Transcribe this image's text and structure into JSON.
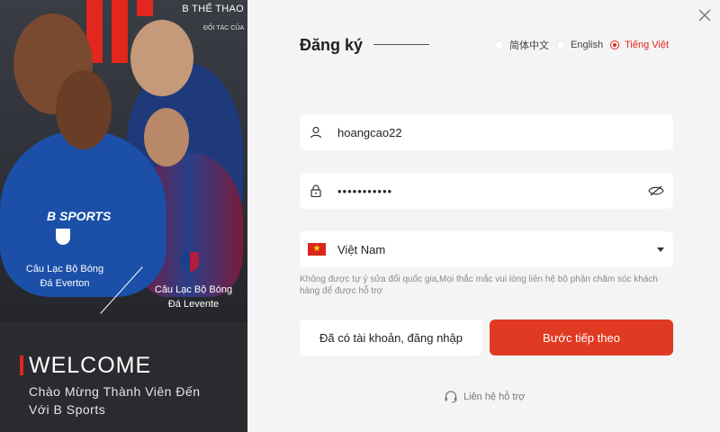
{
  "left": {
    "brand_title": "B THỂ THAO",
    "brand_sub": "ĐỐI TÁC CỦA",
    "club_everton": "Câu Lạc Bộ Bóng\nĐá Everton",
    "club_levante": "Câu Lạc Bộ Bóng\nĐá Levente",
    "jersey_text": "B SPORTS",
    "welcome_title": "WELCOME",
    "welcome_line1": "Chào Mừng Thành Viên Đến",
    "welcome_line2": "Với B  Sports"
  },
  "form": {
    "title": "Đăng ký",
    "languages": [
      {
        "label": "简体中文",
        "selected": false
      },
      {
        "label": "English",
        "selected": false
      },
      {
        "label": "Tiếng Việt",
        "selected": true
      }
    ],
    "username": "hoangcao22",
    "password_masked": "•••••••••••",
    "country": "Việt Nam",
    "note": "Không được tự ý sửa đổi quốc gia,Mọi thắc mắc vui lòng liên hệ bộ phận chăm sóc khách hàng để được hỗ trợ",
    "login_button": "Đã có tài khoản, đăng nhập",
    "next_button": "Bước tiếp theo",
    "support_link": "Liên hệ hỗ trợ"
  },
  "colors": {
    "accent": "#e3261e",
    "button_primary": "#e03a22",
    "left_bg": "#2a2b2f",
    "right_bg": "#f4f4f4"
  },
  "icons": [
    "user-icon",
    "lock-icon",
    "eye-off-icon",
    "vietnam-flag-icon",
    "chevron-down-icon",
    "headset-icon",
    "close-icon"
  ]
}
